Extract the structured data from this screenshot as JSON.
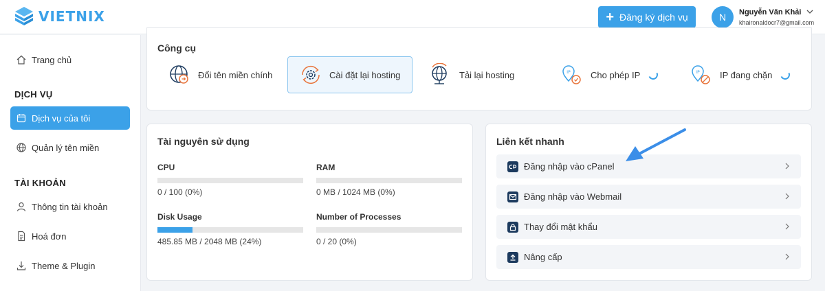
{
  "header": {
    "logo_text": "VIETNIX",
    "register_button": "Đăng ký dịch vụ",
    "avatar_initial": "N",
    "user_name": "Nguyễn Văn Khải",
    "user_email": "khaironaldocr7@gmail.com"
  },
  "sidebar": {
    "home": "Trang chủ",
    "services_heading": "DỊCH VỤ",
    "my_services": "Dịch vụ của tôi",
    "domains": "Quản lý tên miền",
    "account_heading": "TÀI KHOẢN",
    "account_info": "Thông tin tài khoản",
    "invoices": "Hoá đơn",
    "themes": "Theme & Plugin"
  },
  "tools": {
    "title": "Công cụ",
    "items": [
      {
        "label": "Đổi tên miền chính",
        "icon": "globe-arrows-icon"
      },
      {
        "label": "Cài đặt lại hosting",
        "icon": "gear-refresh-icon"
      },
      {
        "label": "Tải lại hosting",
        "icon": "globe-reload-icon"
      },
      {
        "label": "Cho phép IP",
        "icon": "ip-allow-icon"
      },
      {
        "label": "IP đang chặn",
        "icon": "ip-block-icon"
      }
    ]
  },
  "resources": {
    "title": "Tài nguyên sử dụng",
    "cpu_label": "CPU",
    "cpu_value": "0 / 100 (0%)",
    "cpu_fraction": 0,
    "ram_label": "RAM",
    "ram_value": "0 MB / 1024 MB (0%)",
    "ram_fraction": 0,
    "disk_label": "Disk Usage",
    "disk_value": "485.85 MB / 2048 MB (24%)",
    "disk_fraction": 0.24,
    "proc_label": "Number of Processes",
    "proc_value": "0 / 20 (0%)",
    "proc_fraction": 0
  },
  "quicklinks": {
    "title": "Liên kết nhanh",
    "cpanel": "Đăng nhập vào cPanel",
    "webmail": "Đăng nhập vào Webmail",
    "password": "Thay đổi mật khẩu",
    "upgrade": "Nâng cấp"
  },
  "colors": {
    "accent": "#3ba1e8",
    "icon_dark": "#1c3a5e",
    "tool_orange": "#e8743b"
  }
}
